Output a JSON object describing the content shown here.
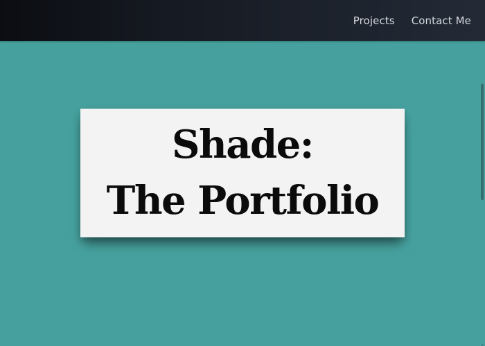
{
  "navbar": {
    "links": [
      {
        "label": "Projects"
      },
      {
        "label": "Contact Me"
      }
    ]
  },
  "hero": {
    "title_line1": "Shade:",
    "title_line2": "The Portfolio"
  },
  "colors": {
    "page_background": "#46a19e",
    "navbar_background": "#161a22",
    "card_background": "#f3f3f3",
    "title_text": "#0b0b0b",
    "nav_text": "#d6d9de"
  },
  "icons": {
    "resize_grip": "resize-grip-icon"
  }
}
